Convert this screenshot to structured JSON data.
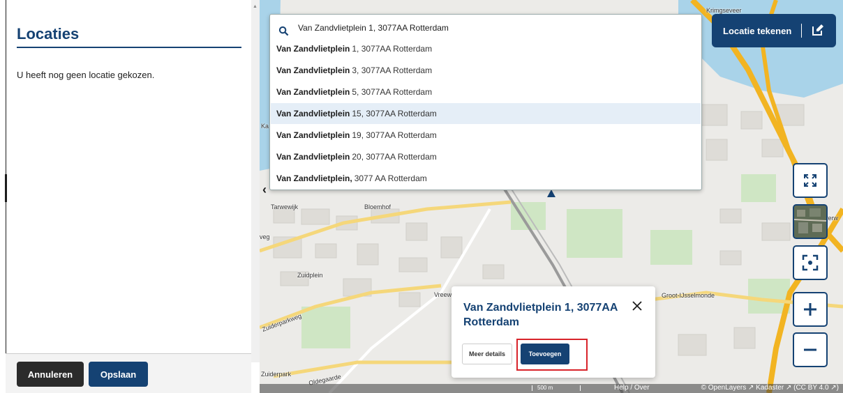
{
  "panel": {
    "title": "Locaties",
    "empty_message": "U heeft nog geen locatie gekozen.",
    "cancel_label": "Annuleren",
    "save_label": "Opslaan"
  },
  "search": {
    "value": "Van Zandvlietplein 1, 3077AA Rotterdam",
    "suggestions": [
      {
        "bold": "Van Zandvlietplein",
        "rest": "1, 3077AA Rotterdam"
      },
      {
        "bold": "Van Zandvlietplein",
        "rest": "3, 3077AA Rotterdam"
      },
      {
        "bold": "Van Zandvlietplein",
        "rest": "5, 3077AA Rotterdam"
      },
      {
        "bold": "Van Zandvlietplein",
        "rest": "15, 3077AA Rotterdam"
      },
      {
        "bold": "Van Zandvlietplein",
        "rest": "19, 3077AA Rotterdam"
      },
      {
        "bold": "Van Zandvlietplein",
        "rest": "20, 3077AA Rotterdam"
      },
      {
        "bold": "Van Zandvlietplein,",
        "rest": "3077 AA Rotterdam"
      }
    ]
  },
  "draw_button": {
    "label": "Locatie tekenen"
  },
  "map": {
    "labels": {
      "krimpen": "Krimgseveer",
      "tarwewijk": "Tarwewijk",
      "bloemhof": "Bloemhof",
      "zuidplein": "Zuidplein",
      "vreewijk": "Vreewi",
      "groot_ijsselmonde": "Groot-IJsselmonde",
      "zuiderpark": "Zuiderpark",
      "zuiderparkweg": "Zuiderparkweg",
      "oldegaarde": "Oldegaarde",
      "veg": "veg",
      "ka": "Ka",
      "verw": "verw"
    }
  },
  "popup": {
    "title": "Van Zandvlietplein 1, 3077AA Rotterdam",
    "details_label": "Meer details",
    "add_label": "Toevoegen"
  },
  "attribution": {
    "help": "Help / Over",
    "credits": "© OpenLayers ↗ Kadaster ↗ (CC BY 4.0 ↗)",
    "scale": "500 m"
  },
  "colors": {
    "brand": "#154273",
    "highlight": "#d8232a",
    "water": "#a9d3e9",
    "highway": "#f2b422"
  }
}
